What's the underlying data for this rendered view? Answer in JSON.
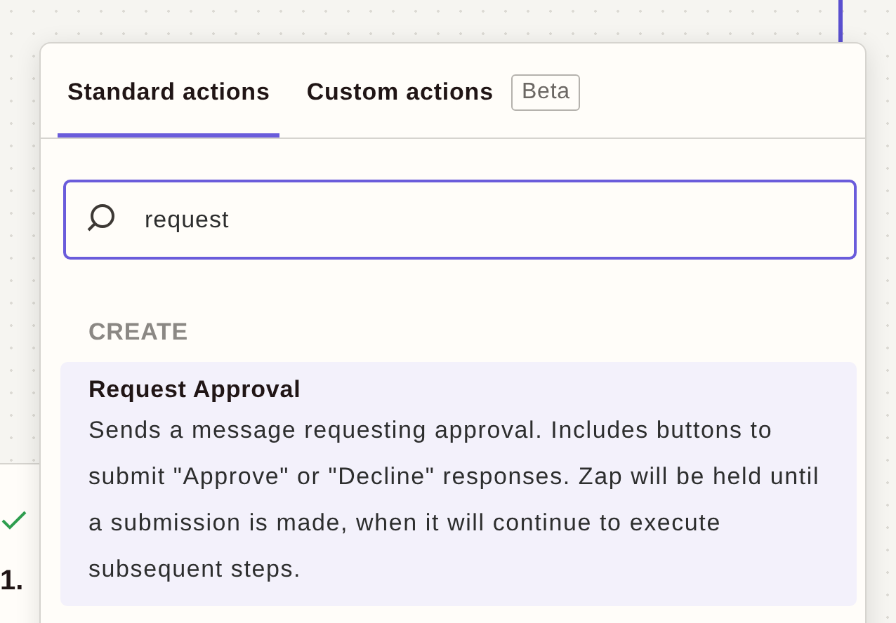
{
  "canvas": {
    "step_label": "1."
  },
  "tabs": [
    {
      "label": "Standard actions",
      "selected": true
    },
    {
      "label": "Custom actions",
      "selected": false,
      "badge": "Beta"
    }
  ],
  "search": {
    "value": "request"
  },
  "groups": [
    {
      "heading": "CREATE",
      "results": [
        {
          "title": "Request Approval",
          "description": "Sends a message requesting approval. Includes buttons to submit \"Approve\" or \"Decline\" responses. Zap will be held until a submission is made, when it will continue to execute subsequent steps.",
          "selected": true
        }
      ]
    }
  ]
}
